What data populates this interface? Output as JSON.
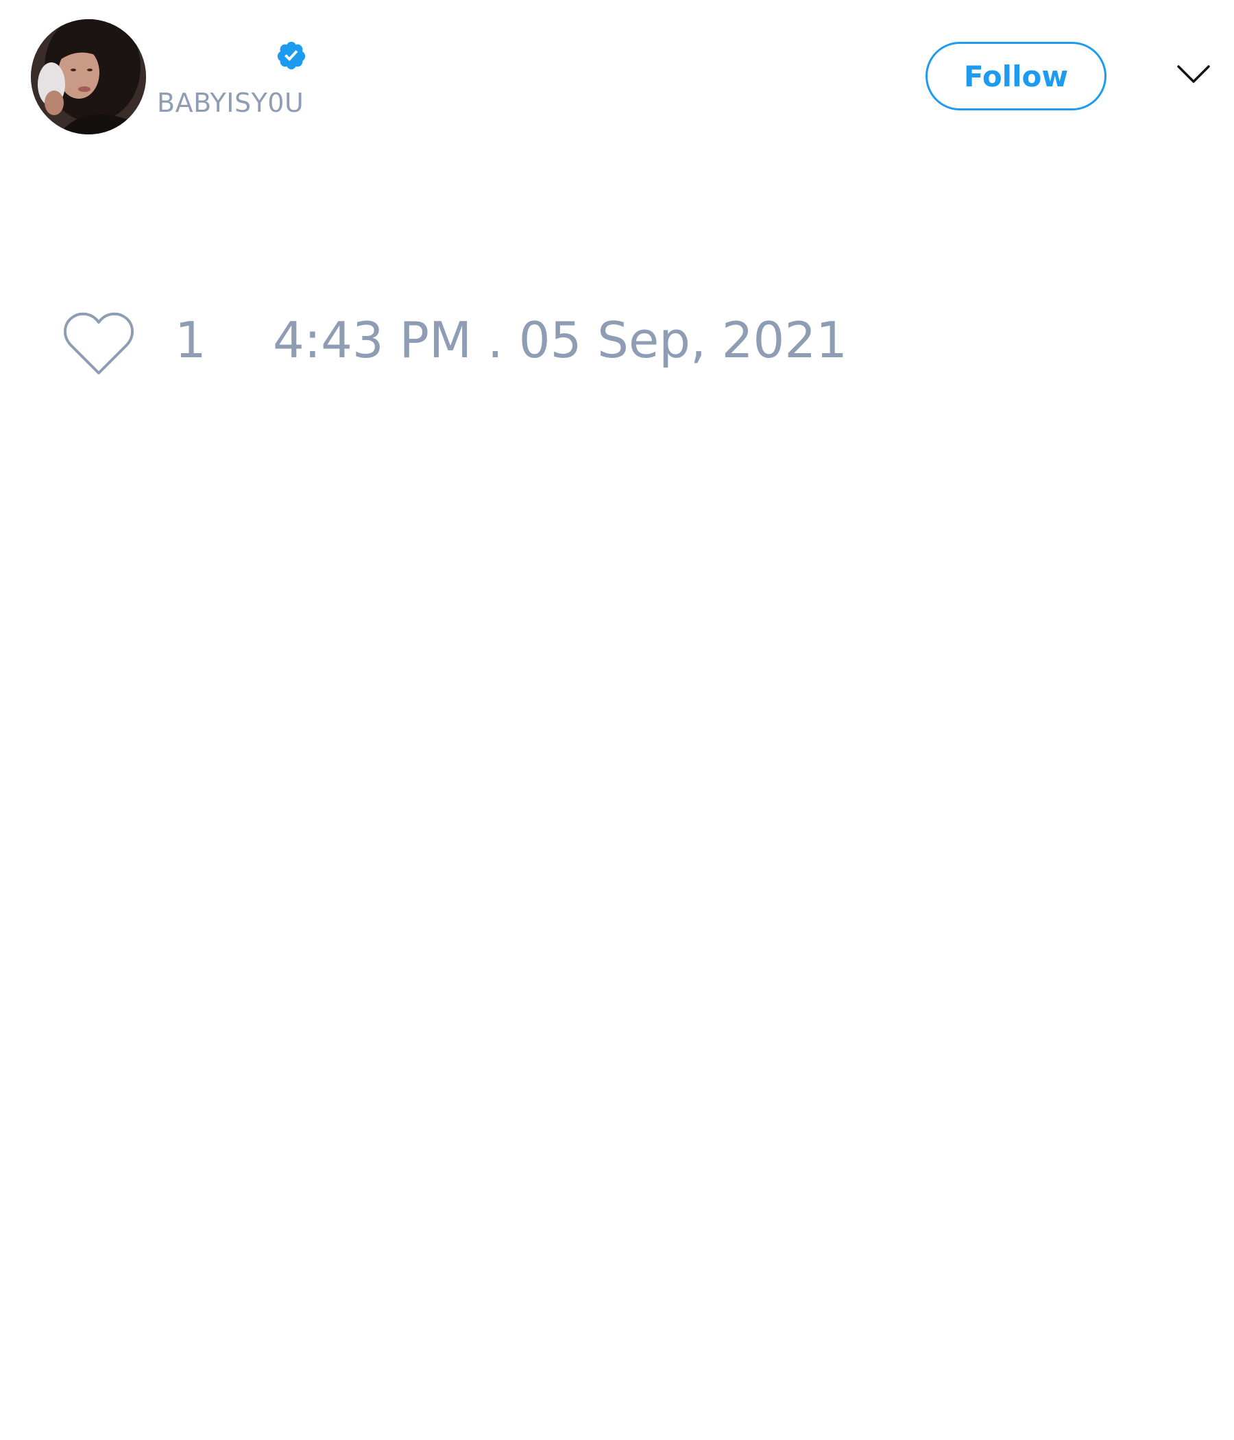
{
  "author": {
    "handle": "BABYISY0U",
    "verified": true,
    "avatar": "profile-photo"
  },
  "actions": {
    "follow_label": "Follow",
    "more_icon": "chevron-down-icon"
  },
  "footer": {
    "like_icon": "heart-outline-icon",
    "like_count": "1",
    "timestamp": "4:43 PM . 05 Sep, 2021"
  },
  "colors": {
    "accent": "#1d9bf0",
    "muted_text": "#8e9db3",
    "background": "#ffffff"
  }
}
